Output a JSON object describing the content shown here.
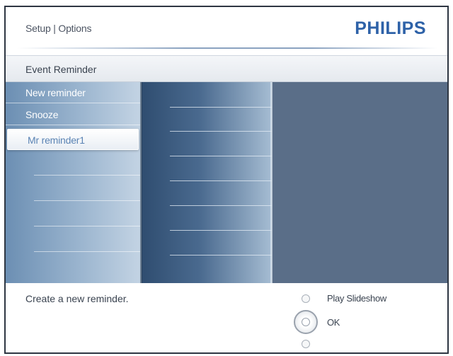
{
  "header": {
    "breadcrumb": "Setup | Options",
    "brand": "PHILIPS"
  },
  "section": {
    "title": "Event Reminder"
  },
  "menu": {
    "items": [
      {
        "label": "New reminder",
        "selected": false
      },
      {
        "label": "Snooze",
        "selected": false
      },
      {
        "label": "Mr reminder1",
        "selected": true
      }
    ]
  },
  "footer": {
    "hint": "Create a new reminder.",
    "controls": {
      "up_label": "Play Slideshow",
      "ok_label": "OK"
    }
  },
  "colors": {
    "brand": "#2e62a8",
    "panel_dark": "#5a6e88",
    "selected_text": "#5b84b4"
  }
}
